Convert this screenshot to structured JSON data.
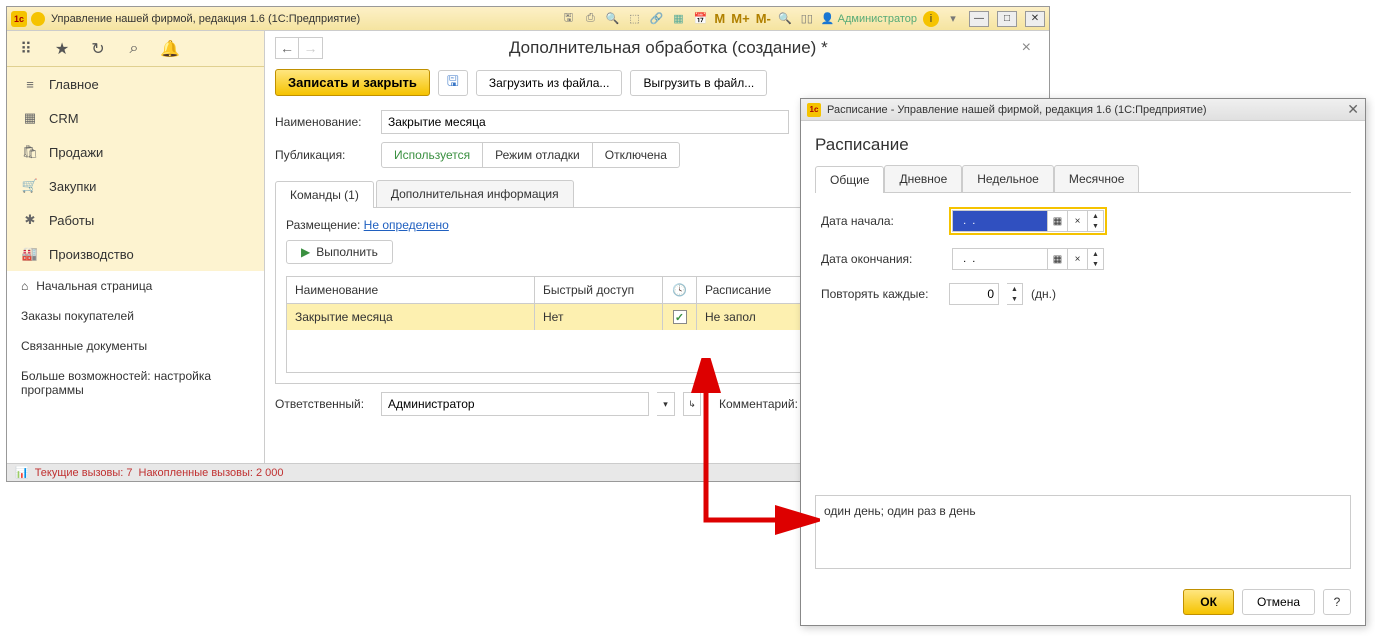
{
  "titlebar": {
    "app_title": "Управление нашей фирмой, редакция 1.6  (1С:Предприятие)",
    "m_label": "M",
    "m_plus": "M+",
    "m_minus": "M-",
    "admin_label": "Администратор"
  },
  "sidebar": {
    "items": [
      {
        "label": "Главное"
      },
      {
        "label": "CRM"
      },
      {
        "label": "Продажи"
      },
      {
        "label": "Закупки"
      },
      {
        "label": "Работы"
      },
      {
        "label": "Производство"
      }
    ],
    "secondary": [
      {
        "label": "Начальная страница"
      },
      {
        "label": "Заказы покупателей"
      },
      {
        "label": "Связанные документы"
      },
      {
        "label": "Больше возможностей: настройка программы"
      }
    ]
  },
  "document": {
    "title": "Дополнительная обработка (создание) *",
    "save_close": "Записать и закрыть",
    "load_file": "Загрузить из файла...",
    "export_file": "Выгрузить в файл...",
    "name_label": "Наименование:",
    "name_value": "Закрытие месяца",
    "pub_label": "Публикация:",
    "pub_options": [
      "Используется",
      "Режим отладки",
      "Отключена"
    ],
    "tabs": [
      "Команды (1)",
      "Дополнительная информация"
    ],
    "placement_label": "Размещение:",
    "placement_value": "Не определено",
    "execute": "Выполнить",
    "grid_headers": [
      "Наименование",
      "Быстрый доступ",
      "",
      "Расписание"
    ],
    "grid_row": {
      "name": "Закрытие месяца",
      "quick": "Нет",
      "sched": "Не запол"
    },
    "responsible_label": "Ответственный:",
    "responsible_value": "Администратор",
    "comment_label": "Комментарий:"
  },
  "status": {
    "current": "Текущие вызовы: 7",
    "accumulated": "Накопленные вызовы: 2 000"
  },
  "dialog": {
    "title": "Расписание - Управление нашей фирмой, редакция 1.6  (1С:Предприятие)",
    "heading": "Расписание",
    "tabs": [
      "Общие",
      "Дневное",
      "Недельное",
      "Месячное"
    ],
    "start_label": "Дата начала:",
    "start_value": "  .  .",
    "end_label": "Дата окончания:",
    "end_value": "  .  .    ",
    "repeat_label": "Повторять каждые:",
    "repeat_value": "0",
    "repeat_unit": "(дн.)",
    "description": "один день; один раз в день",
    "ok": "ОК",
    "cancel": "Отмена",
    "help": "?"
  }
}
